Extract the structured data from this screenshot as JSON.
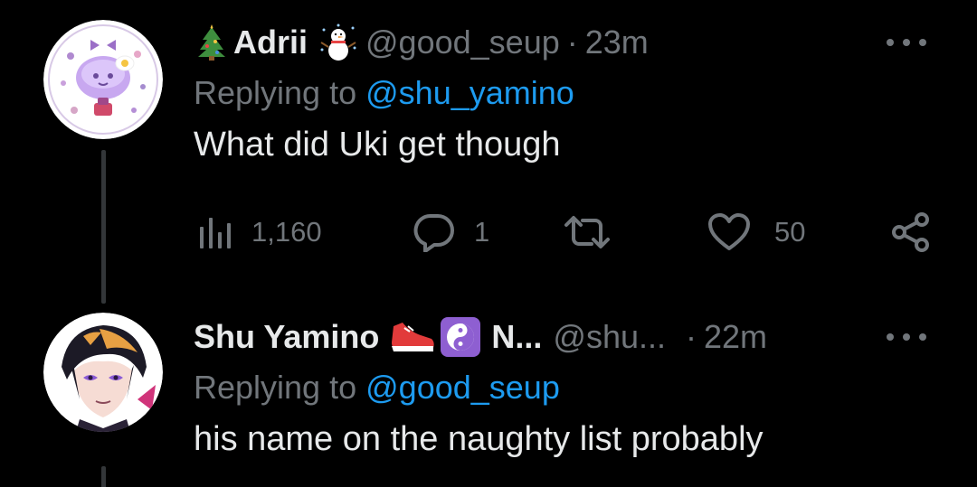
{
  "tweets": [
    {
      "display_name": "Adrii",
      "name_emoji_left": "christmas-tree",
      "name_emoji_right": "snowman",
      "handle": "@good_seup",
      "separator": "·",
      "time": "23m",
      "reply_prefix": "Replying to",
      "reply_to": "@shu_yamino",
      "text": "What did Uki get though",
      "stats": {
        "views": "1,160",
        "replies": "1",
        "retweets": "",
        "likes": "50"
      }
    },
    {
      "display_name": "Shu Yamino",
      "name_emoji_1": "running-shoe",
      "name_emoji_2": "yin-yang",
      "name_suffix": "N...",
      "handle": "@shu...",
      "separator": "·",
      "time": "22m",
      "reply_prefix": "Replying to",
      "reply_to": "@good_seup",
      "text": "his name on the naughty list probably"
    }
  ],
  "colors": {
    "background": "#000000",
    "primary_text": "#e7e9ea",
    "secondary_text": "#71767b",
    "link": "#1d9bf0",
    "thread_line": "#333639"
  }
}
